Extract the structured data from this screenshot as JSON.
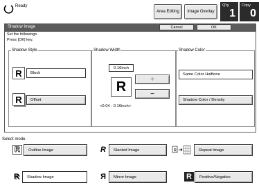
{
  "status": {
    "ready_label": "Ready",
    "area_editing": "Area Editing",
    "image_overlay": "Image Overlay",
    "qty_label": "Q'ty",
    "qty_value": "1",
    "copy_label": "Copy",
    "copy_value": "0"
  },
  "dialog": {
    "title": "Shadow Image",
    "cancel_label": "Cancel",
    "ok_label": "OK",
    "instruction_line1": "Set the followings.",
    "instruction_line2": "Press [OK] key."
  },
  "shadow_style": {
    "title": "Shadow Style",
    "options": [
      "Block",
      "Offset"
    ]
  },
  "shadow_width": {
    "title": "Shadow Width",
    "value": "0.16inch",
    "plus": "+",
    "minus": "−",
    "range": "<0.04 - 0.16inch>"
  },
  "shadow_color": {
    "title": "Shadow Color",
    "options": [
      "Same Color Halftone",
      "Shadow Color / Density"
    ]
  },
  "modes": {
    "select_label": "Select mode.",
    "items": [
      "Outline Image",
      "Slanted Image",
      "Repeat Image",
      "Shadow Image",
      "Mirror Image",
      "Positive/Negative"
    ]
  }
}
